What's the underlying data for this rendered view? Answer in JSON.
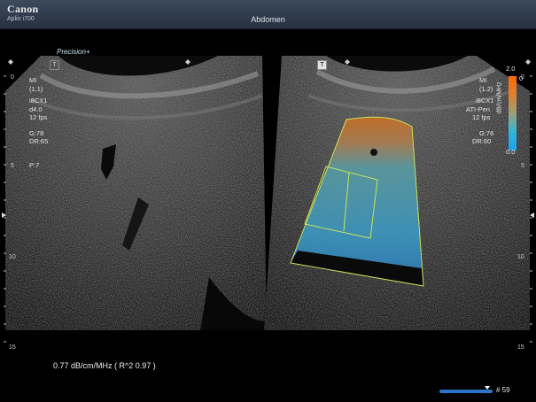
{
  "header": {
    "brand": "Canon",
    "model": "Aplio i700",
    "preset": "Abdomen"
  },
  "precision": {
    "text": "Precision",
    "suffix": "+"
  },
  "left_panel": {
    "mi": "MI",
    "mi_val": "(1.1)",
    "probe": "i8CX1",
    "depth": "d4.0",
    "fps": "12 fps",
    "gain": "G:78",
    "dr": "DR:65",
    "persist": "P:7",
    "marker": "T"
  },
  "right_panel": {
    "mi": "MI",
    "mi_val": "(1.2)",
    "probe": "i8CX1",
    "mode": "ATI-Pen",
    "fps": "12 fps",
    "gain": "G:76",
    "dr": "DR:60",
    "marker": "T",
    "colorbar": {
      "max": "2.0",
      "zero": "0",
      "min": "0.0",
      "unit": "dB/cm/MHz"
    }
  },
  "depth_scale": {
    "ticks": [
      "0",
      "5",
      "10",
      "15"
    ]
  },
  "measurement": {
    "text": "0.77 dB/cm/MHz   ( R^2 0.97 )"
  },
  "cine": {
    "frame": "# 59",
    "position": 0.9
  },
  "colors": {
    "accent": "#2b74c9",
    "roi": "#c8e25a",
    "bar_top": "#ff6a00",
    "bar_bottom": "#1ca0f0"
  }
}
